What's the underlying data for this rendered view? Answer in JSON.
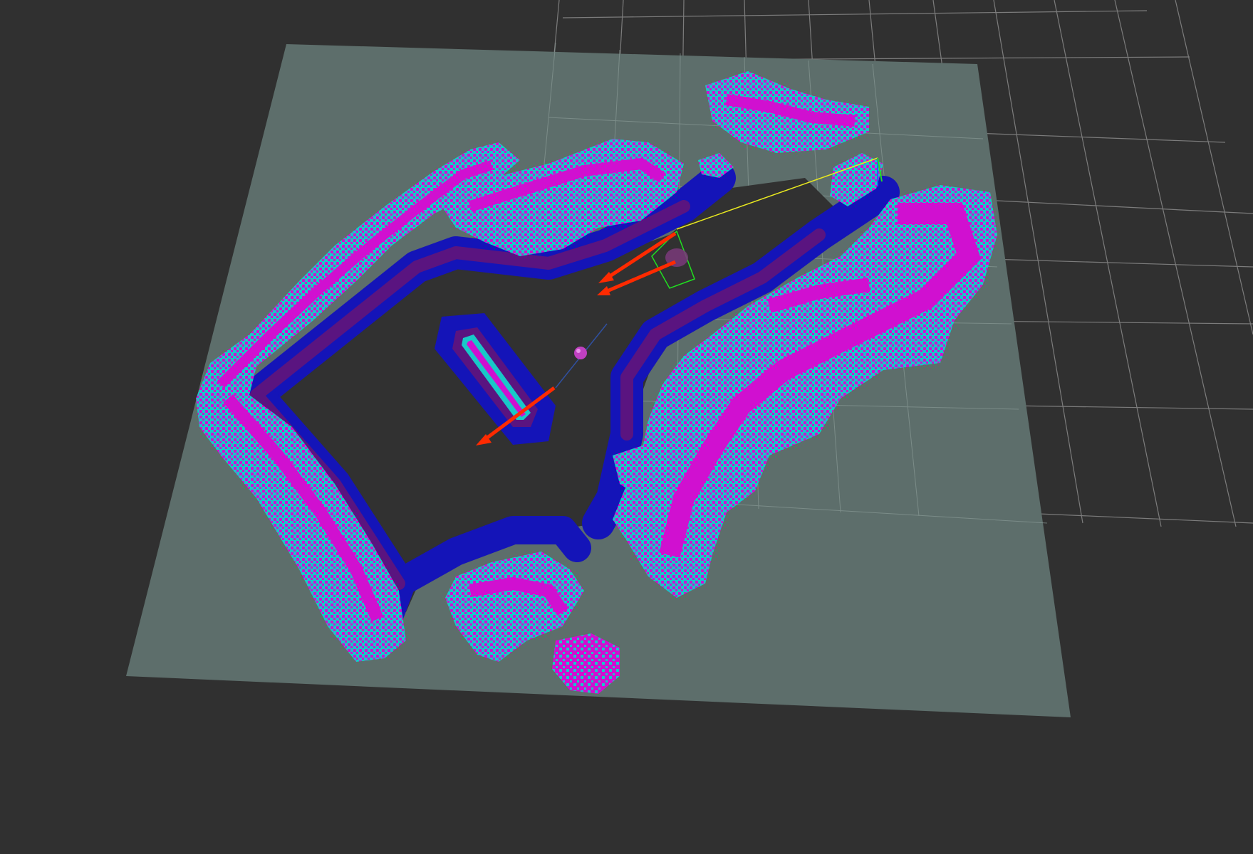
{
  "viewport": {
    "background_color": "#303030",
    "grid_color": "#9a9a9a",
    "map_free_color": "#5d6e6b",
    "map_unknown_color": "#313131",
    "costmap_colors": {
      "lethal": "#d010d0",
      "inscribed": "#18c8c8",
      "inflation_outer": "#1414b8",
      "inflation_inner": "#5a1480"
    },
    "markers": {
      "pose_arrow_color": "#ff2a00",
      "path_color": "#e8e820",
      "goal_axis_color": "#20e020",
      "robot_sphere_color": "#c040c0",
      "line_color": "#3050a0"
    },
    "icons": {
      "arrow": "pose-arrow-icon",
      "sphere": "robot-sphere-icon",
      "axes": "tf-axes-icon"
    }
  }
}
